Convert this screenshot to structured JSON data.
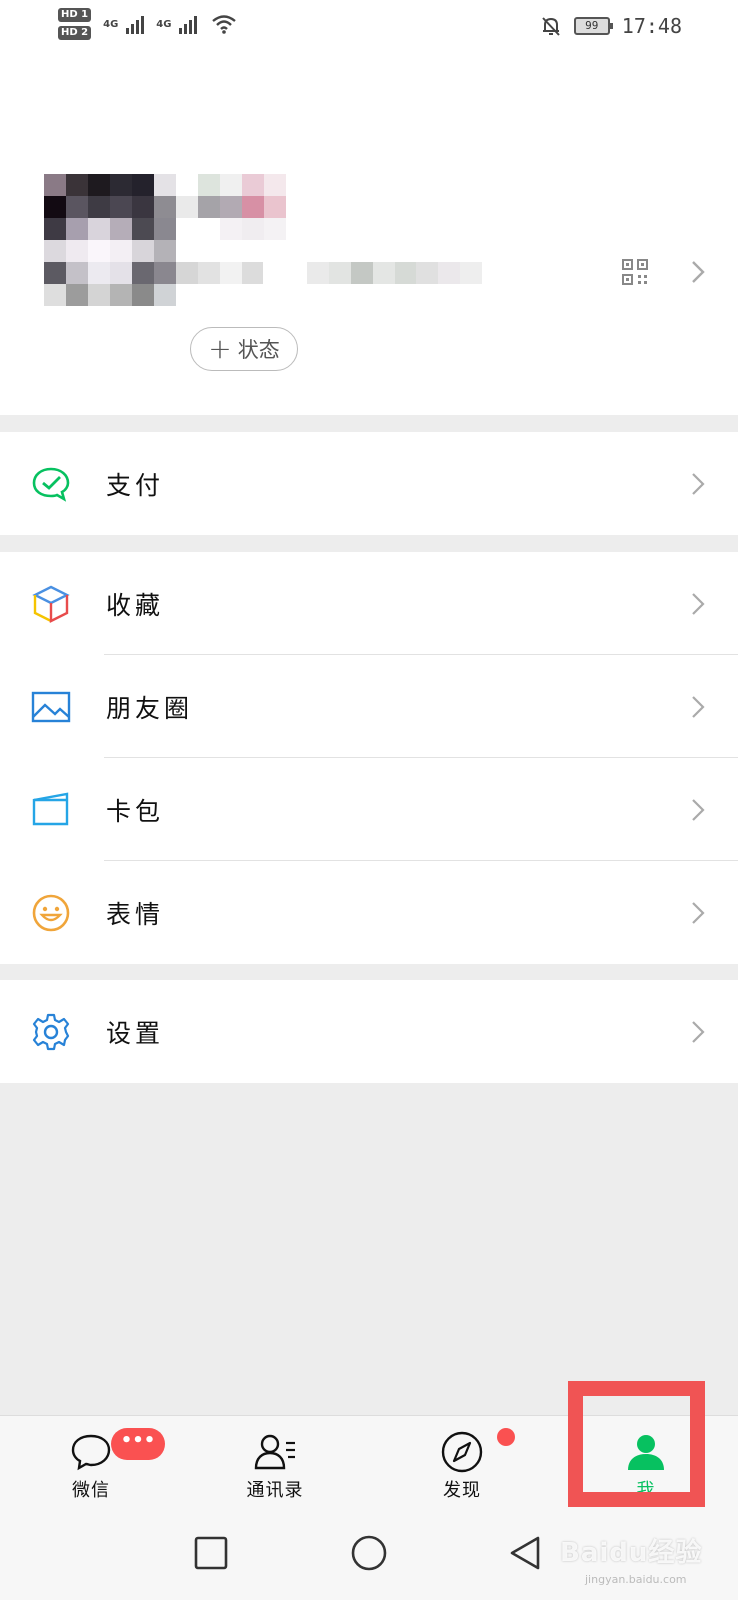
{
  "status_bar": {
    "sim1": "HD 1",
    "sim2": "HD 2",
    "net1": "4G",
    "net2": "4G",
    "battery": "99",
    "time": "17:48",
    "icons": [
      "wifi-icon",
      "mute-bell-icon"
    ]
  },
  "profile": {
    "status_button_label": "状态",
    "status_button_icon": "plus-icon",
    "qr_icon": "qr-code-icon"
  },
  "menu": {
    "pay": {
      "label": "支付",
      "icon": "wechat-pay-icon",
      "color": "#07c160"
    },
    "favorites": {
      "label": "收藏",
      "icon": "cube-icon"
    },
    "moments": {
      "label": "朋友圈",
      "icon": "picture-icon",
      "color": "#2782d7"
    },
    "card_wallet": {
      "label": "卡包",
      "icon": "card-icon",
      "color": "#25a5e6"
    },
    "stickers": {
      "label": "表情",
      "icon": "smiley-icon",
      "color": "#f0a53a"
    },
    "settings": {
      "label": "设置",
      "icon": "gear-icon",
      "color": "#2782d7"
    }
  },
  "tabbar": {
    "chats": {
      "label": "微信",
      "badge": "•••",
      "icon": "chat-bubble-icon"
    },
    "contacts": {
      "label": "通讯录",
      "icon": "contacts-icon"
    },
    "discover": {
      "label": "发现",
      "icon": "compass-icon"
    },
    "me": {
      "label": "我",
      "icon": "person-icon",
      "active": true
    }
  },
  "colors": {
    "accent": "#07c160",
    "badge": "#fa5151",
    "highlight_box": "#f05454",
    "background": "#ededed"
  },
  "watermark": {
    "text": "Baidu经验",
    "sub": "jingyan.baidu.com"
  }
}
